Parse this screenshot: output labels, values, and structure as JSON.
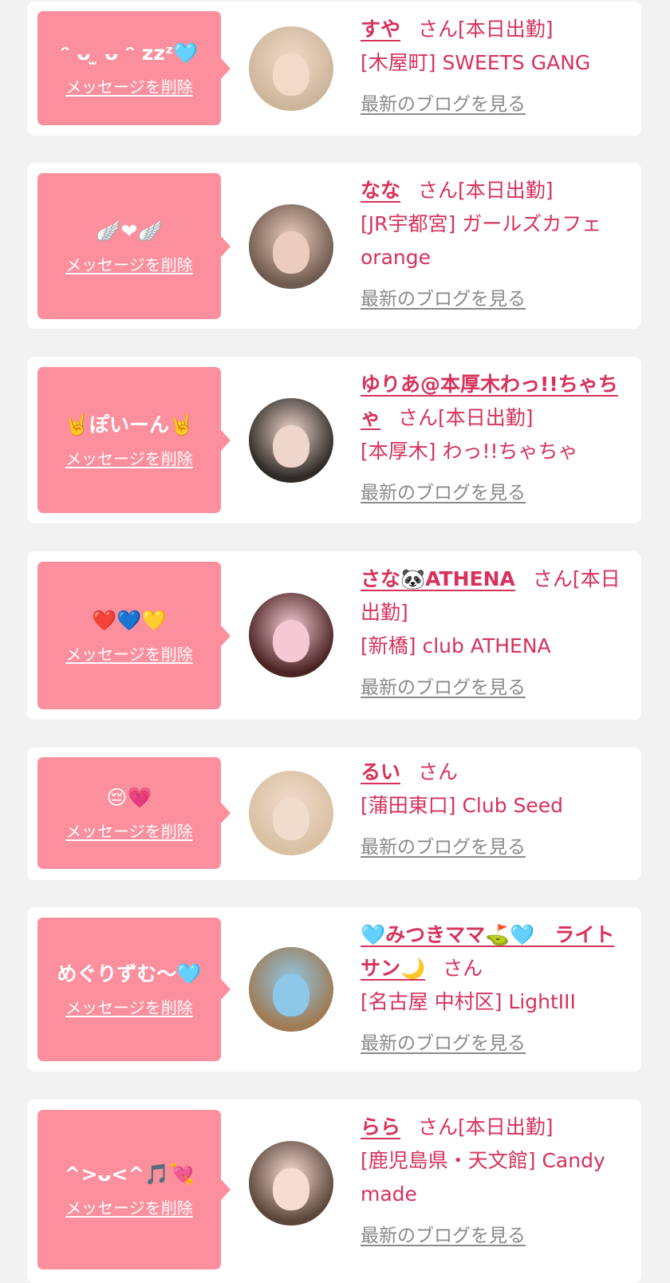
{
  "delete_label": "メッセージを削除",
  "blog_label": "最新のブログを見る",
  "san_suffix": "さん",
  "cards": [
    {
      "message": "ᵔ ᴗ ̫ ᴗ ᵔ zzᶻ🩵",
      "name": "すや",
      "status": "[本日出勤]",
      "shop": "[木屋町] SWEETS GANG",
      "avatar_colors": [
        "#cdb59c",
        "#f3d9c8"
      ]
    },
    {
      "message": "🪽❤🪽",
      "name": "なな",
      "status": "[本日出勤]",
      "shop": "[JR宇都宮] ガールズカフェorange",
      "avatar_colors": [
        "#6e5a4e",
        "#eccdbd"
      ]
    },
    {
      "message": "🤘ぽいーん🤘",
      "name": "ゆりあ@本厚木わっ!!ちゃちゃ",
      "status": "[本日出勤]",
      "shop": "[本厚木] わっ!!ちゃちゃ",
      "avatar_colors": [
        "#2e2a26",
        "#efd6cc"
      ]
    },
    {
      "message": "❤️💙💛",
      "name": "さな🐼ATHENA",
      "status": "[本日出勤]",
      "shop": "[新橋] club ATHENA",
      "avatar_colors": [
        "#4b2322",
        "#f4c9d4"
      ]
    },
    {
      "message": "😔💗",
      "name": "るい",
      "status": "",
      "shop": "[蒲田東口] Club Seed",
      "avatar_colors": [
        "#d9c0a2",
        "#f0dccd"
      ]
    },
    {
      "message": "めぐりずむ〜🩵",
      "name": "🩵みつきママ⛳️🩵　ライトサン🌙",
      "status": "",
      "shop": "[名古屋 中村区] LightIII",
      "avatar_colors": [
        "#a07a52",
        "#8ec8e8"
      ]
    },
    {
      "message": "^>ᴗ<^🎵💘",
      "name": "らら",
      "status": "[本日出勤]",
      "shop": "[鹿児島県・天文館] Candy made",
      "avatar_colors": [
        "#5b463a",
        "#f5ddd4"
      ]
    }
  ]
}
